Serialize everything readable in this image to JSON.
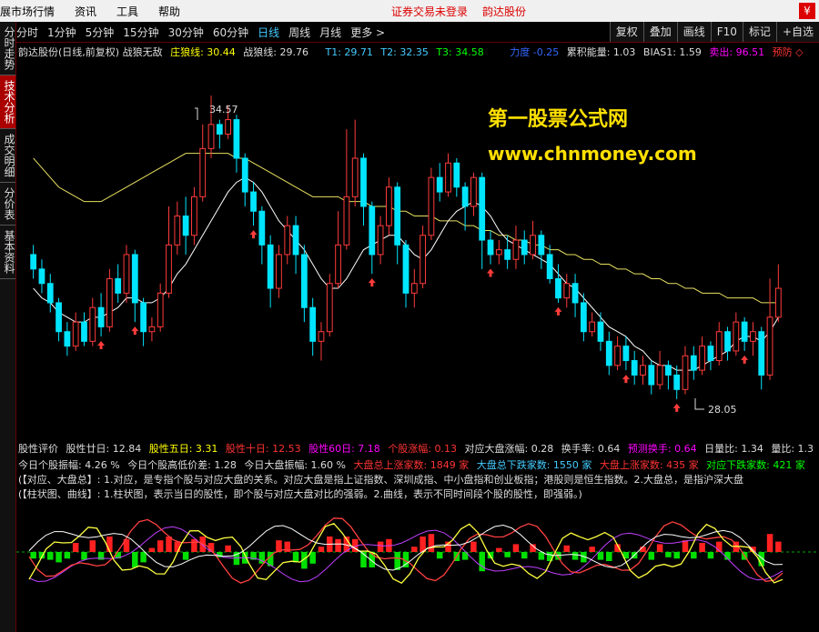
{
  "menu": {
    "items": [
      "展市场行情",
      "资讯",
      "工具",
      "帮助"
    ],
    "status": "证券交易未登录",
    "stock_name": "韵达股份"
  },
  "period_bar": {
    "items": [
      "分时",
      "1分钟",
      "5分钟",
      "15分钟",
      "30分钟",
      "60分钟",
      "日线",
      "周线",
      "月线",
      "更多 >"
    ],
    "active": "日线",
    "tools": [
      "复权",
      "叠加",
      "画线",
      "F10",
      "标记",
      "+自选"
    ]
  },
  "side_tabs": [
    "分时走势",
    "技术分析",
    "成交明细",
    "分价表",
    "基本资料"
  ],
  "side_active": "技术分析",
  "main_info": {
    "title": "韵达股份(日线,前复权) 战狼无敌",
    "zhuang_label": "庄狼线: 30.44",
    "zhan_label": "战狼线: 29.76",
    "t1": "T1: 29.71",
    "t2": "T2: 32.35",
    "t3": "T3: 34.58",
    "power": "力度 -0.25",
    "accum": "累积能量: 1.03",
    "bias": "BIAS1: 1.59",
    "sell": "卖出: 96.51",
    "warn": "预防 ◇"
  },
  "watermark": {
    "line1": "第一股票公式网",
    "line2": "www.chnmoney.com"
  },
  "price_labels": {
    "high": "34.57",
    "low": "28.05"
  },
  "sub_info": {
    "line1": [
      "股性评价",
      "股性廿日: 12.84",
      "股性五日: 3.31",
      "股性十日: 12.53",
      "股性60日: 7.18",
      "个股涨幅: 0.13",
      "对应大盘涨幅: 0.28",
      "换手率: 0.64",
      "预测换手: 0.64",
      "日量比: 1.34",
      "量比: 1.3"
    ],
    "line2": [
      "今日个股振幅: 4.26 %",
      "今日个股高低价差: 1.28",
      "今日大盘振幅: 1.60 %",
      "大盘总上涨家数: 1849 家",
      "大盘总下跌家数: 1550 家",
      "大盘上涨家数: 435 家",
      "对应下跌家数: 421 家"
    ],
    "line3": "(【对应、大盘总】: 1.对应，是专指个股与对应大盘的关系。对应大盘是指上证指数、深圳成指、中小盘指和创业板指；港股则是恒生指数。2.大盘总，是指沪深大盘",
    "line4": "(【柱状图、曲线】: 1.柱状图，表示当日的股性，即个股与对应大盘对比的强弱。2.曲线，表示不同时间段个股的股性，即强弱。)"
  },
  "chart_data": {
    "type": "candlestick",
    "ylim": [
      27.5,
      35.2
    ],
    "high_label": 34.57,
    "low_label": 28.05,
    "candles": [
      [
        31.2,
        30.9,
        31.4,
        30.7
      ],
      [
        30.9,
        30.6,
        31.1,
        30.4
      ],
      [
        30.6,
        30.2,
        30.8,
        30.0
      ],
      [
        30.2,
        29.6,
        30.3,
        29.4
      ],
      [
        29.6,
        29.3,
        29.8,
        29.1
      ],
      [
        29.3,
        29.8,
        30.0,
        29.2
      ],
      [
        29.8,
        29.4,
        30.0,
        29.3
      ],
      [
        29.4,
        30.1,
        30.3,
        29.3
      ],
      [
        30.1,
        29.7,
        30.4,
        29.5
      ],
      [
        29.7,
        30.7,
        30.9,
        29.6
      ],
      [
        30.7,
        30.4,
        31.0,
        30.2
      ],
      [
        30.4,
        31.2,
        31.4,
        30.2
      ],
      [
        31.2,
        30.2,
        31.3,
        29.8
      ],
      [
        30.2,
        29.6,
        30.3,
        29.3
      ],
      [
        29.6,
        29.7,
        29.9,
        29.4
      ],
      [
        29.7,
        30.4,
        30.6,
        29.6
      ],
      [
        30.4,
        31.4,
        32.2,
        30.3
      ],
      [
        31.4,
        32.0,
        32.3,
        31.2
      ],
      [
        32.0,
        31.6,
        32.4,
        31.2
      ],
      [
        31.6,
        32.4,
        32.6,
        31.4
      ],
      [
        32.4,
        33.4,
        33.9,
        32.3
      ],
      [
        33.4,
        33.9,
        34.5,
        33.2
      ],
      [
        33.9,
        33.7,
        34.0,
        33.4
      ],
      [
        33.7,
        34.0,
        34.3,
        33.6
      ],
      [
        34.0,
        33.2,
        34.1,
        32.9
      ],
      [
        33.2,
        32.5,
        33.3,
        32.2
      ],
      [
        32.5,
        32.1,
        32.7,
        31.8
      ],
      [
        32.1,
        31.4,
        32.2,
        31.0
      ],
      [
        31.4,
        30.5,
        31.6,
        30.1
      ],
      [
        30.5,
        31.2,
        31.4,
        30.3
      ],
      [
        31.2,
        31.8,
        32.0,
        31.0
      ],
      [
        31.8,
        31.2,
        32.0,
        30.8
      ],
      [
        31.2,
        30.1,
        31.4,
        29.8
      ],
      [
        30.1,
        29.4,
        30.3,
        29.1
      ],
      [
        29.4,
        29.6,
        29.8,
        29.0
      ],
      [
        29.6,
        30.6,
        30.8,
        29.5
      ],
      [
        30.6,
        31.4,
        32.1,
        30.5
      ],
      [
        31.4,
        32.4,
        33.8,
        31.3
      ],
      [
        32.4,
        33.2,
        34.0,
        32.2
      ],
      [
        33.2,
        32.2,
        33.3,
        31.8
      ],
      [
        32.2,
        31.2,
        32.3,
        30.8
      ],
      [
        31.2,
        31.8,
        32.0,
        31.0
      ],
      [
        31.8,
        32.6,
        32.8,
        31.6
      ],
      [
        32.6,
        31.4,
        32.7,
        31.0
      ],
      [
        31.4,
        30.4,
        31.5,
        30.1
      ],
      [
        30.4,
        30.6,
        30.9,
        30.1
      ],
      [
        30.6,
        31.6,
        31.8,
        30.5
      ],
      [
        31.6,
        32.8,
        33.0,
        31.5
      ],
      [
        32.8,
        32.5,
        33.1,
        32.3
      ],
      [
        32.5,
        33.1,
        33.3,
        32.4
      ],
      [
        33.1,
        32.6,
        33.2,
        32.4
      ],
      [
        32.6,
        32.2,
        32.7,
        31.7
      ],
      [
        32.2,
        32.8,
        32.9,
        32.0
      ],
      [
        32.8,
        31.5,
        32.9,
        30.9
      ],
      [
        31.5,
        31.2,
        31.7,
        31.0
      ],
      [
        31.2,
        31.3,
        31.5,
        31.0
      ],
      [
        31.3,
        31.1,
        31.6,
        30.9
      ],
      [
        31.1,
        31.5,
        31.8,
        30.9
      ],
      [
        31.5,
        31.2,
        31.7,
        31.0
      ],
      [
        31.2,
        31.6,
        31.9,
        31.1
      ],
      [
        31.6,
        31.2,
        31.7,
        30.9
      ],
      [
        31.2,
        30.7,
        31.4,
        30.6
      ],
      [
        30.7,
        30.3,
        31.0,
        30.2
      ],
      [
        30.3,
        30.6,
        30.8,
        30.1
      ],
      [
        30.6,
        30.2,
        30.8,
        29.9
      ],
      [
        30.2,
        29.6,
        30.4,
        29.4
      ],
      [
        29.6,
        29.8,
        30.0,
        29.5
      ],
      [
        29.8,
        29.4,
        30.0,
        29.2
      ],
      [
        29.4,
        28.9,
        29.6,
        28.7
      ],
      [
        28.9,
        29.3,
        29.5,
        28.8
      ],
      [
        29.3,
        29.0,
        29.5,
        28.8
      ],
      [
        29.0,
        28.7,
        29.2,
        28.5
      ],
      [
        28.7,
        28.9,
        29.1,
        28.5
      ],
      [
        28.9,
        28.5,
        29.0,
        28.3
      ],
      [
        28.5,
        28.9,
        29.2,
        28.4
      ],
      [
        28.9,
        28.7,
        29.0,
        28.4
      ],
      [
        28.7,
        28.4,
        28.9,
        28.2
      ],
      [
        28.4,
        29.1,
        29.3,
        28.3
      ],
      [
        29.1,
        28.8,
        29.3,
        28.6
      ],
      [
        28.8,
        29.3,
        29.5,
        28.7
      ],
      [
        29.3,
        29.0,
        29.4,
        28.8
      ],
      [
        29.0,
        29.6,
        29.8,
        28.9
      ],
      [
        29.6,
        29.2,
        29.7,
        29.0
      ],
      [
        29.2,
        29.8,
        30.0,
        29.1
      ],
      [
        29.8,
        29.4,
        29.9,
        29.2
      ],
      [
        29.4,
        29.6,
        29.8,
        29.1
      ],
      [
        29.6,
        28.7,
        29.7,
        28.4
      ],
      [
        28.7,
        29.9,
        30.7,
        28.6
      ],
      [
        29.9,
        30.5,
        31.0,
        29.8
      ]
    ],
    "ma_white": [
      30.5,
      30.3,
      30.2,
      30.0,
      29.9,
      29.8,
      29.8,
      29.9,
      29.9,
      30.0,
      30.1,
      30.3,
      30.3,
      30.2,
      30.2,
      30.3,
      30.5,
      30.8,
      31.0,
      31.3,
      31.6,
      31.9,
      32.2,
      32.5,
      32.7,
      32.8,
      32.7,
      32.5,
      32.2,
      31.9,
      31.7,
      31.5,
      31.3,
      31.0,
      30.7,
      30.5,
      30.5,
      30.7,
      31.0,
      31.3,
      31.4,
      31.5,
      31.6,
      31.6,
      31.4,
      31.2,
      31.1,
      31.3,
      31.6,
      31.9,
      32.1,
      32.2,
      32.3,
      32.2,
      32.0,
      31.7,
      31.5,
      31.4,
      31.3,
      31.2,
      31.1,
      31.0,
      30.8,
      30.6,
      30.5,
      30.3,
      30.1,
      29.9,
      29.7,
      29.6,
      29.5,
      29.3,
      29.2,
      29.0,
      28.9,
      28.9,
      28.8,
      28.8,
      28.8,
      28.9,
      29.0,
      29.1,
      29.2,
      29.4,
      29.5,
      29.5,
      29.4,
      29.6,
      29.9
    ],
    "ma_yellow": [
      33.2,
      33.0,
      32.8,
      32.6,
      32.5,
      32.4,
      32.3,
      32.3,
      32.3,
      32.4,
      32.5,
      32.6,
      32.7,
      32.8,
      32.9,
      33.0,
      33.1,
      33.2,
      33.3,
      33.3,
      33.3,
      33.3,
      33.3,
      33.3,
      33.2,
      33.2,
      33.1,
      33.0,
      32.9,
      32.8,
      32.7,
      32.6,
      32.5,
      32.4,
      32.4,
      32.4,
      32.4,
      32.3,
      32.3,
      32.3,
      32.2,
      32.2,
      32.2,
      32.1,
      32.1,
      32.0,
      32.0,
      32.0,
      31.9,
      31.9,
      31.9,
      31.8,
      31.8,
      31.7,
      31.7,
      31.6,
      31.6,
      31.5,
      31.5,
      31.4,
      31.4,
      31.3,
      31.3,
      31.2,
      31.2,
      31.1,
      31.1,
      31.0,
      31.0,
      30.9,
      30.9,
      30.8,
      30.8,
      30.7,
      30.7,
      30.6,
      30.6,
      30.5,
      30.5,
      30.4,
      30.4,
      30.4,
      30.3,
      30.3,
      30.3,
      30.3,
      30.2,
      30.2,
      30.2
    ]
  },
  "colors": {
    "up": "#ff3b3b",
    "down": "#00e5ff",
    "ma_white": "#ffffff",
    "ma_yellow": "#e8e060",
    "purple": "#c040ff",
    "green_bar": "#00e000",
    "red_bar": "#ff2020"
  }
}
